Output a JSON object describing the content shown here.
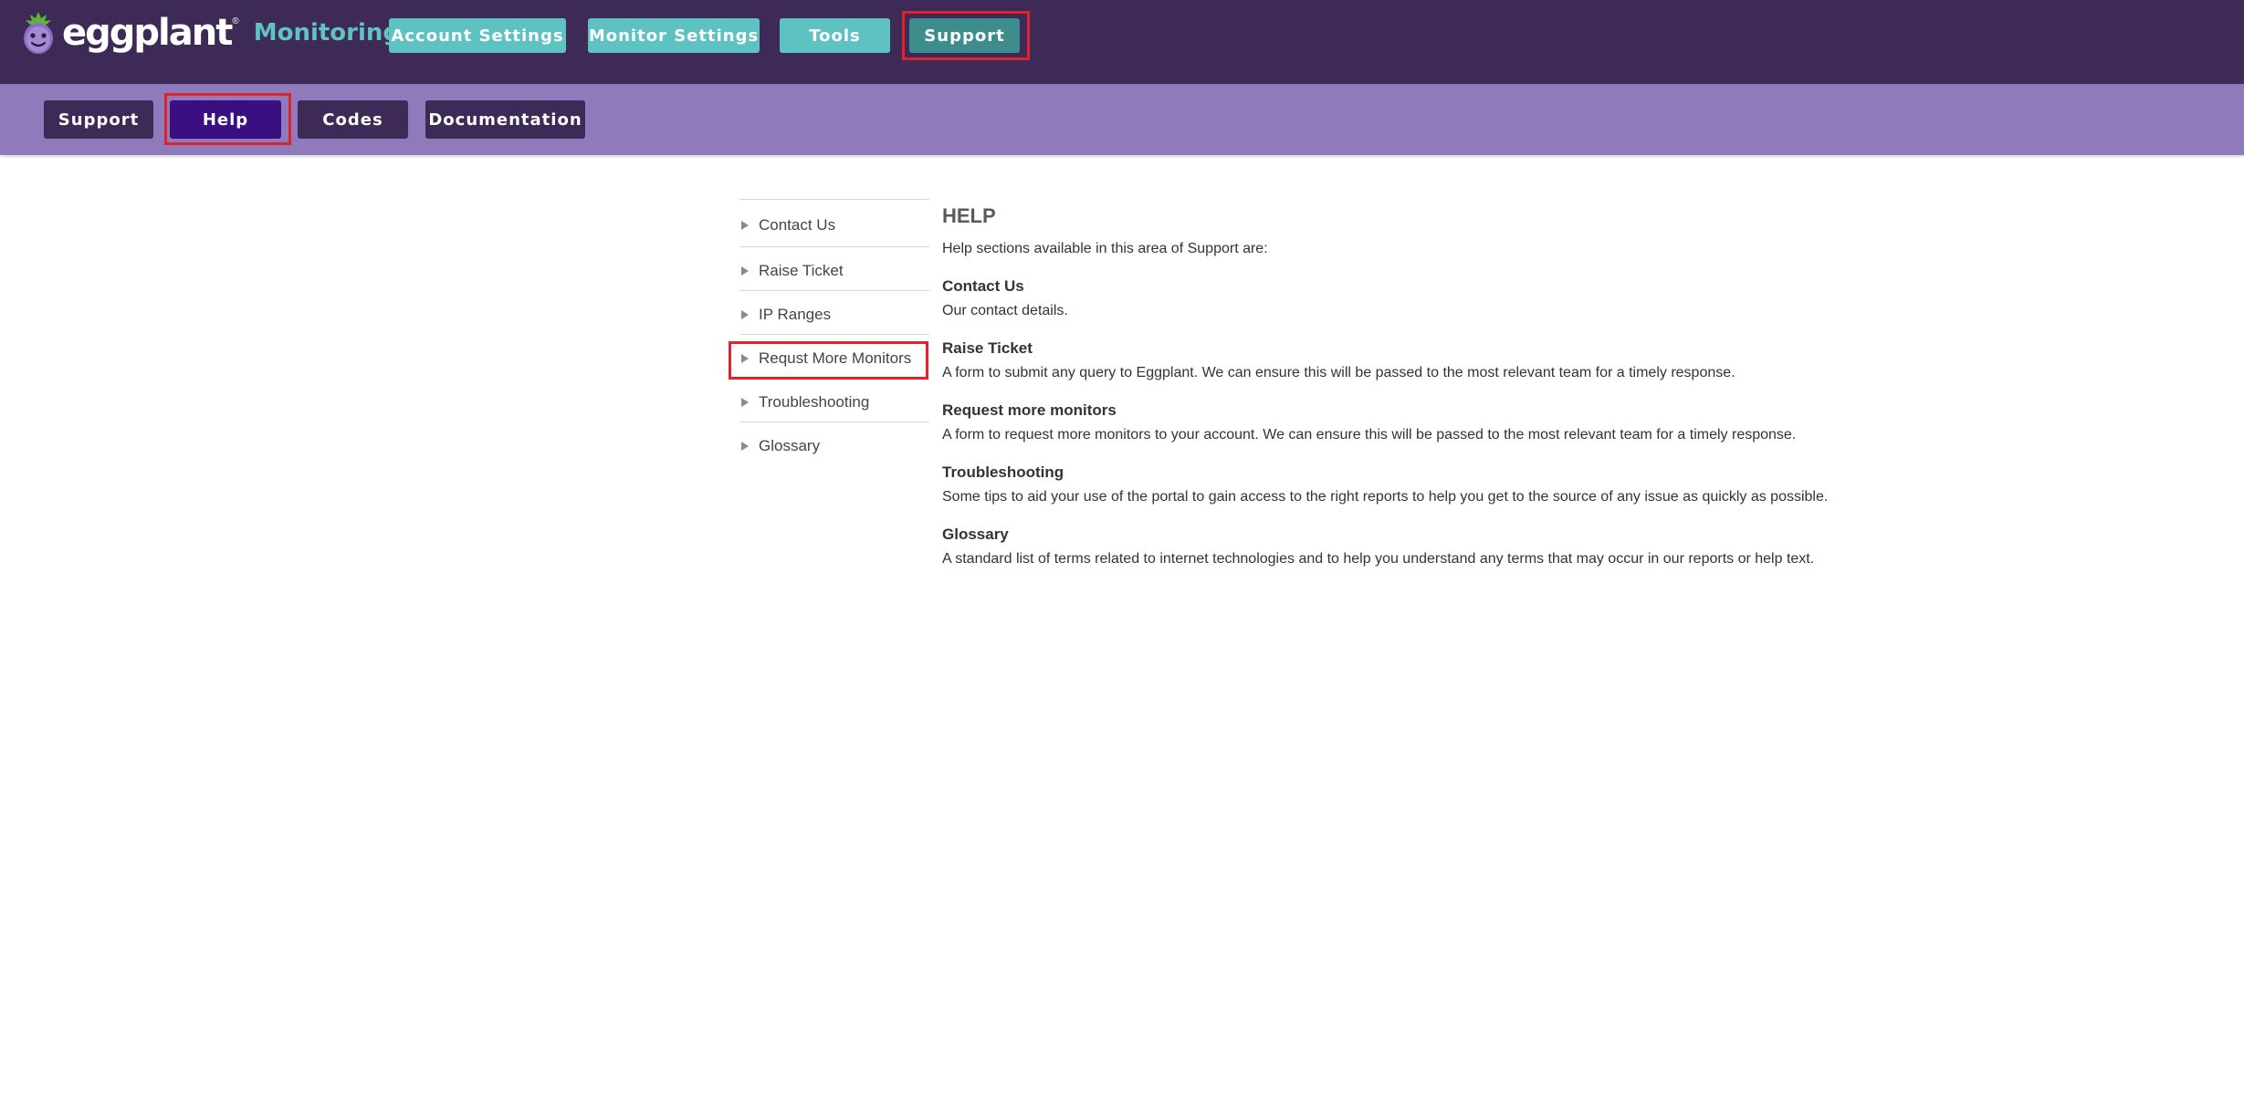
{
  "header": {
    "logo_text": "eggplant",
    "logo_reg": "®",
    "product_name": "Monitoring",
    "nav": [
      {
        "label": "Account Settings"
      },
      {
        "label": "Monitor Settings"
      },
      {
        "label": "Tools"
      },
      {
        "label": "Support"
      }
    ],
    "active_nav": "Support"
  },
  "subnav": {
    "items": [
      {
        "label": "Support"
      },
      {
        "label": "Help"
      },
      {
        "label": "Codes"
      },
      {
        "label": "Documentation"
      }
    ],
    "active": "Help"
  },
  "sidebar": {
    "items": [
      {
        "label": "Contact Us"
      },
      {
        "label": "Raise Ticket"
      },
      {
        "label": "IP Ranges"
      },
      {
        "label": "Requst More Monitors"
      },
      {
        "label": "Troubleshooting"
      },
      {
        "label": "Glossary"
      }
    ]
  },
  "main": {
    "title": "HELP",
    "intro": "Help sections available in this area of Support are:",
    "sections": [
      {
        "title": "Contact Us",
        "description": "Our contact details."
      },
      {
        "title": "Raise Ticket",
        "description": "A form to submit any query to Eggplant. We can ensure this will be passed to the most relevant team for a timely response."
      },
      {
        "title": "Request more monitors",
        "description": "A form to request more monitors to your account. We can ensure this will be passed to the most relevant team for a timely response."
      },
      {
        "title": "Troubleshooting",
        "description": "Some tips to aid your use of the portal to gain access to the right reports to help you get to the source of any issue as quickly as possible."
      },
      {
        "title": "Glossary",
        "description": "A standard list of terms related to internet technologies and to help you understand any terms that may occur in our reports or help text."
      }
    ]
  },
  "colors": {
    "topbar": "#3d2a56",
    "subbar": "#8f7bbb",
    "teal": "#5ec2c2",
    "highlight": "#e0232a"
  }
}
